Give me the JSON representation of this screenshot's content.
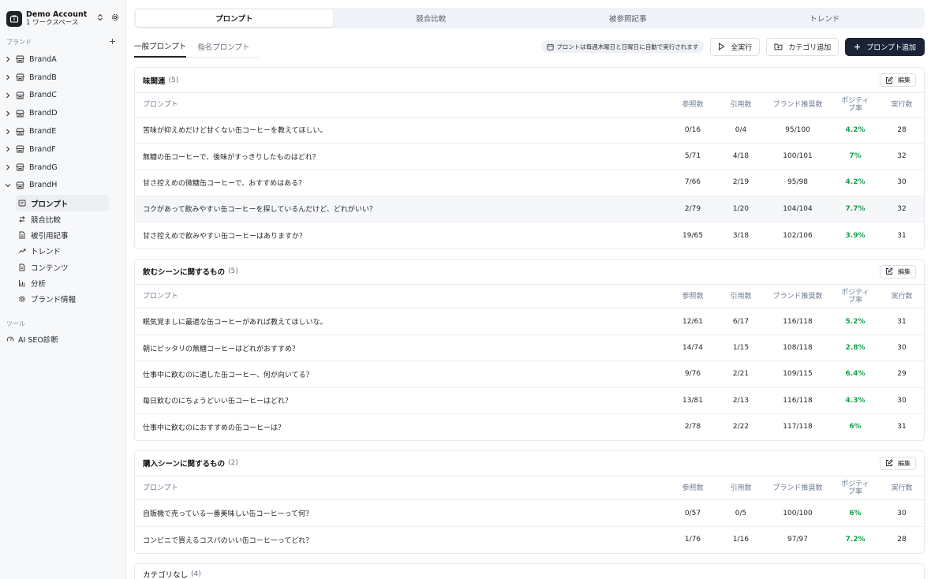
{
  "account": {
    "name": "Demo Account",
    "workspace": "1 ワークスペース"
  },
  "sidebar": {
    "brands_label": "ブランド",
    "brands": [
      "BrandA",
      "BrandB",
      "BrandC",
      "BrandD",
      "BrandE",
      "BrandF",
      "BrandG",
      "BrandH"
    ],
    "brandh_items": [
      {
        "label": "プロンプト",
        "icon": "prompt-icon"
      },
      {
        "label": "競合比較",
        "icon": "swap-icon"
      },
      {
        "label": "被引用記事",
        "icon": "document-icon"
      },
      {
        "label": "トレンド",
        "icon": "trend-icon"
      },
      {
        "label": "コンテンツ",
        "icon": "content-icon"
      },
      {
        "label": "分析",
        "icon": "bar-chart-icon"
      },
      {
        "label": "ブランド情報",
        "icon": "gear-icon"
      }
    ],
    "tools_label": "ツール",
    "tools": [
      {
        "label": "AI SEO診断",
        "icon": "gauge-icon"
      }
    ]
  },
  "top_tabs": [
    "プロンプト",
    "競合比較",
    "被参照記事",
    "トレンド"
  ],
  "sub_tabs": [
    "一般プロンプト",
    "指名プロンプト"
  ],
  "toolbar": {
    "notice": "プロントは毎週木曜日と日曜日に自動で実行されます",
    "run_all": "全実行",
    "add_category": "カテゴリ追加",
    "add_prompt": "プロンプト追加"
  },
  "table_headers": {
    "prompt": "プロンプト",
    "refs": "参照数",
    "citations": "引用数",
    "brand_recs": "ブランド推奨数",
    "positive_1": "ポジティ",
    "positive_2": "ブ率",
    "runs": "実行数"
  },
  "edit_label": "編集",
  "categories": [
    {
      "name": "味関連",
      "count": "(5)",
      "rows": [
        {
          "prompt": "苦味が抑えめだけど甘くない缶コーヒーを教えてほしい。",
          "refs": "0/16",
          "citations": "0/4",
          "recs": "95/100",
          "positive": "4.2%",
          "runs": "28"
        },
        {
          "prompt": "無糖の缶コーヒーで、後味がすっきりしたものはどれ？",
          "refs": "5/71",
          "citations": "4/18",
          "recs": "100/101",
          "positive": "7%",
          "runs": "32"
        },
        {
          "prompt": "甘さ控えめの微糖缶コーヒーで、おすすめはある？",
          "refs": "7/66",
          "citations": "2/19",
          "recs": "95/98",
          "positive": "4.2%",
          "runs": "30"
        },
        {
          "prompt": "コクがあって飲みやすい缶コーヒーを探しているんだけど、どれがいい？",
          "refs": "2/79",
          "citations": "1/20",
          "recs": "104/104",
          "positive": "7.7%",
          "runs": "32"
        },
        {
          "prompt": "甘さ控えめで飲みやすい缶コーヒーはありますか？",
          "refs": "19/65",
          "citations": "3/18",
          "recs": "102/106",
          "positive": "3.9%",
          "runs": "31"
        }
      ]
    },
    {
      "name": "飲むシーンに関するもの",
      "count": "(5)",
      "rows": [
        {
          "prompt": "眠気覚ましに最適な缶コーヒーがあれば教えてほしいな。",
          "refs": "12/61",
          "citations": "6/17",
          "recs": "116/118",
          "positive": "5.2%",
          "runs": "31"
        },
        {
          "prompt": "朝にピッタリの無糖コーヒーはどれがおすすめ？",
          "refs": "14/74",
          "citations": "1/15",
          "recs": "108/118",
          "positive": "2.8%",
          "runs": "30"
        },
        {
          "prompt": "仕事中に飲むのに適した缶コーヒー、何が向いてる？",
          "refs": "9/76",
          "citations": "2/21",
          "recs": "109/115",
          "positive": "6.4%",
          "runs": "29"
        },
        {
          "prompt": "毎日飲むのにちょうどいい缶コーヒーはどれ？",
          "refs": "13/81",
          "citations": "2/13",
          "recs": "116/118",
          "positive": "4.3%",
          "runs": "30"
        },
        {
          "prompt": "仕事中に飲むのにおすすめの缶コーヒーは？",
          "refs": "2/78",
          "citations": "2/22",
          "recs": "117/118",
          "positive": "6%",
          "runs": "31"
        }
      ]
    },
    {
      "name": "購入シーンに関するもの",
      "count": "(2)",
      "rows": [
        {
          "prompt": "自販機で売っている一番美味しい缶コーヒーって何？",
          "refs": "0/57",
          "citations": "0/5",
          "recs": "100/100",
          "positive": "6%",
          "runs": "30"
        },
        {
          "prompt": "コンビニで買えるコスパのいい缶コーヒーってどれ？",
          "refs": "1/76",
          "citations": "1/16",
          "recs": "97/97",
          "positive": "7.2%",
          "runs": "28"
        }
      ]
    }
  ],
  "uncategorized": {
    "name": "カテゴリなし",
    "count": "(4)"
  }
}
